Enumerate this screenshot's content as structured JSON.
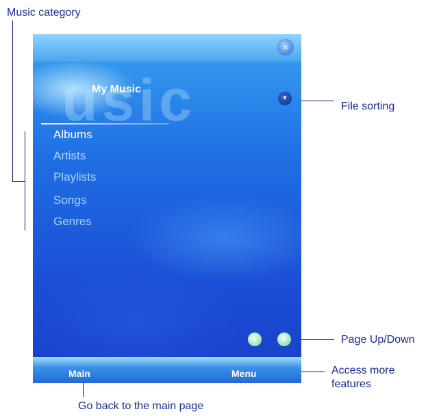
{
  "annotations": {
    "music_category": "Music category",
    "file_sorting": "File sorting",
    "page_updown": "Page Up/Down",
    "access_more_1": "Access more",
    "access_more_2": "features",
    "go_back": "Go back to the main page"
  },
  "screen": {
    "watermark": "usic",
    "title": "My Music",
    "close_icon": "×",
    "sort_icon": "▾",
    "list": [
      "Albums",
      "Artists",
      "Playlists",
      "Songs",
      "Genres"
    ],
    "selected_index": 0,
    "page_up_icon": "▴",
    "page_down_icon": "▾",
    "softkeys": {
      "left": "Main",
      "right": "Menu"
    }
  }
}
